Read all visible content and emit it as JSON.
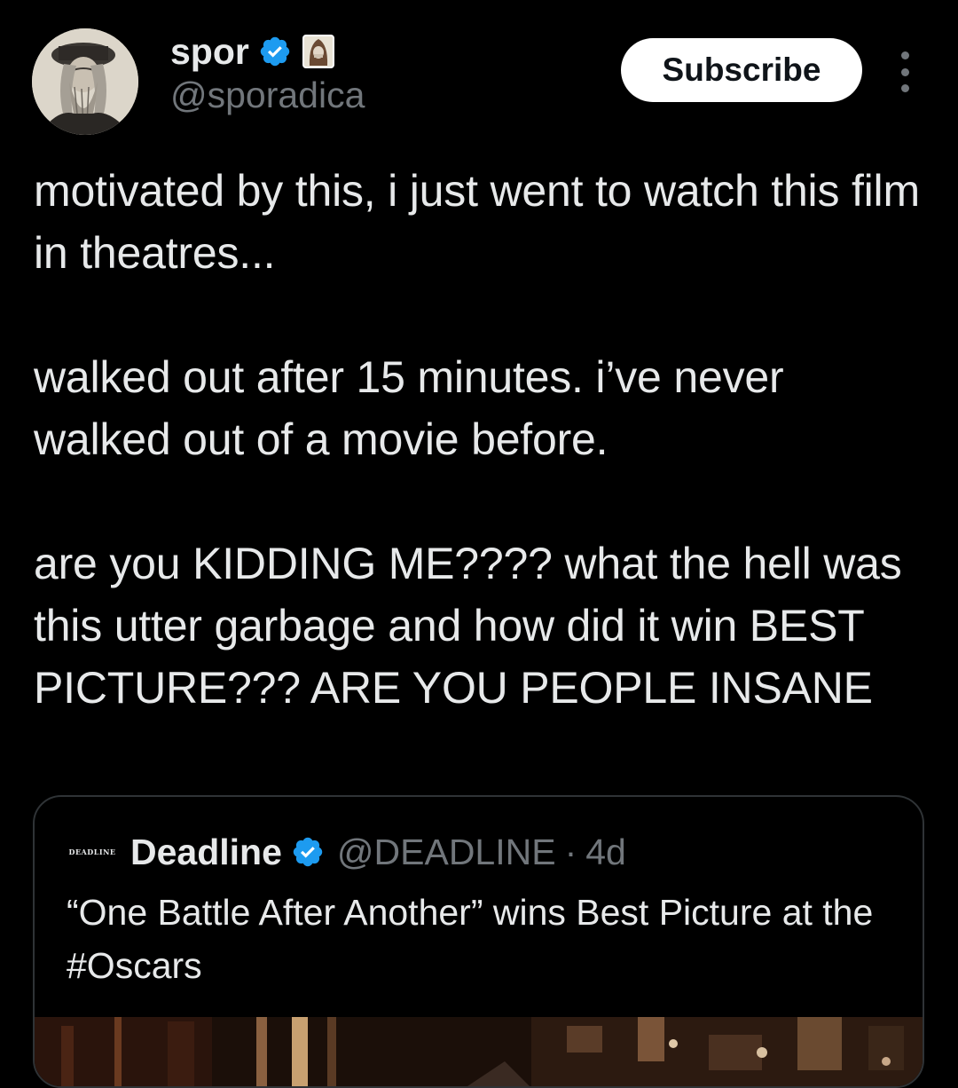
{
  "author": {
    "display_name": "spor",
    "handle": "@sporadica",
    "verified": true,
    "avatar_icon": "bearded-man-portrait-avatar",
    "affiliation_icon": "hooded-figure-badge-icon"
  },
  "actions": {
    "subscribe_label": "Subscribe",
    "more_icon": "more-vertical-icon"
  },
  "tweet": {
    "paragraphs": [
      "motivated by this, i just went to watch this film in theatres...",
      "walked out after 15 minutes. i’ve never walked out of a movie before.",
      "are you KIDDING ME???? what the hell was this utter garbage and how did it win BEST PICTURE??? ARE YOU PEOPLE INSANE"
    ]
  },
  "quote": {
    "logo_text": "DEADLINE",
    "display_name": "Deadline",
    "verified": true,
    "handle": "@DEADLINE",
    "separator": "·",
    "time": "4d",
    "text": "“One Battle After Another” wins Best Picture at the #Oscars",
    "media_icon": "movie-still-image"
  },
  "colors": {
    "background": "#000000",
    "text_primary": "#e7e9ea",
    "text_secondary": "#71767b",
    "verified_blue": "#1d9bf0",
    "card_border": "#2f3336",
    "button_bg": "#ffffff"
  }
}
